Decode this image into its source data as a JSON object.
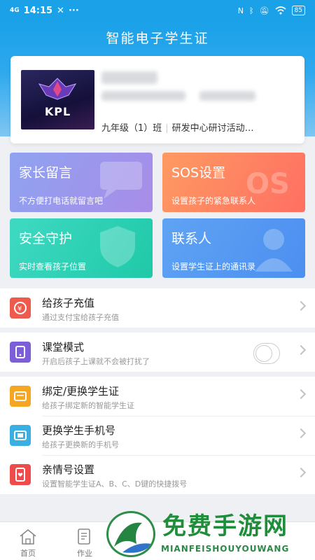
{
  "status_bar": {
    "time": "14:15",
    "signal": "4G",
    "battery": "85"
  },
  "app_title": "智能电子学生证",
  "profile": {
    "class_name": "九年级（1）班",
    "activity": "研发中心研讨活动…",
    "avatar_text": "KPL"
  },
  "tiles": [
    {
      "title": "家长留言",
      "subtitle": "不方便打电话就留言吧"
    },
    {
      "title": "SOS设置",
      "subtitle": "设置孩子的紧急联系人"
    },
    {
      "title": "安全守护",
      "subtitle": "实时查看孩子位置"
    },
    {
      "title": "联系人",
      "subtitle": "设置学生证上的通讯录"
    }
  ],
  "menu": {
    "recharge": {
      "title": "给孩子充值",
      "subtitle": "通过支付宝给孩子充值"
    },
    "class_mode": {
      "title": "课堂模式",
      "subtitle": "开启后孩子上课就不会被打扰了",
      "enabled": false
    },
    "bind": {
      "title": "绑定/更换学生证",
      "subtitle": "给孩子绑定新的智能学生证"
    },
    "phone": {
      "title": "更换学生手机号",
      "subtitle": "给孩子更换新的手机号"
    },
    "family": {
      "title": "亲情号设置",
      "subtitle": "设置智能学生证A、B、C、D键的快捷拨号"
    }
  },
  "tabs": [
    {
      "label": "首页"
    },
    {
      "label": "作业"
    }
  ],
  "watermark": {
    "title": "免费手游网",
    "subtitle": "MIANFEISHOUYOUWANG"
  },
  "colors": {
    "primary": "#1aa1e8",
    "recharge": "#ef5a4f",
    "class_mode": "#7c5fd8",
    "bind": "#f5a623",
    "phone": "#3ab0e2",
    "family": "#ef4b4b"
  }
}
